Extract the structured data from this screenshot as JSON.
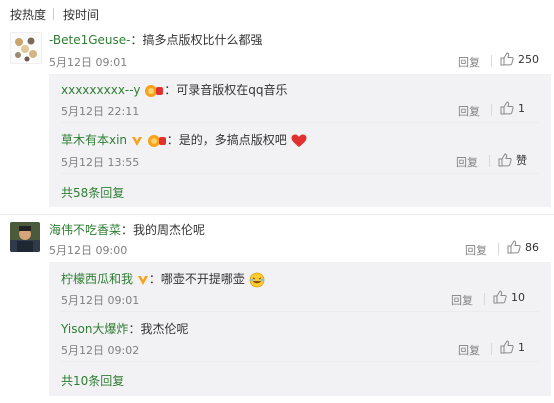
{
  "sort_tabs": {
    "hot": "按热度",
    "time": "按时间"
  },
  "comments": [
    {
      "user": "-Bete1Geuse-",
      "text": "：搞多点版权比什么都强",
      "time": "5月12日 09:01",
      "reply_label": "回复",
      "likes": "250",
      "replies": [
        {
          "user": "xxxxxxxxx--y",
          "text": "：可录音版权在qq音乐",
          "time": "5月12日 22:11",
          "reply_label": "回复",
          "likes": "1"
        },
        {
          "user": "草木有本xin",
          "text": "：是的，多搞点版权吧",
          "time": "5月12日 13:55",
          "reply_label": "回复",
          "likes": "赞"
        }
      ],
      "more_replies": "共58条回复"
    },
    {
      "user": "海伟不吃香菜",
      "text": "：我的周杰伦呢",
      "time": "5月12日 09:00",
      "reply_label": "回复",
      "likes": "86",
      "replies": [
        {
          "user": "柠檬西瓜和我",
          "text": "：哪壶不开提哪壶",
          "time": "5月12日 09:01",
          "reply_label": "回复",
          "likes": "10"
        },
        {
          "user": "Yison大爆炸",
          "text": "：我杰伦呢",
          "time": "5月12日 09:02",
          "reply_label": "回复",
          "likes": "1"
        }
      ],
      "more_replies": "共10条回复"
    }
  ],
  "colors": {
    "username": "#2e7d32",
    "reply_bg": "#f2f2f5",
    "heart": "#e0312e",
    "badge": "#f7a21b"
  },
  "icons": [
    "thumbs-up-icon",
    "heart-icon",
    "vip-badge-icon",
    "emoji-laugh-icon"
  ]
}
